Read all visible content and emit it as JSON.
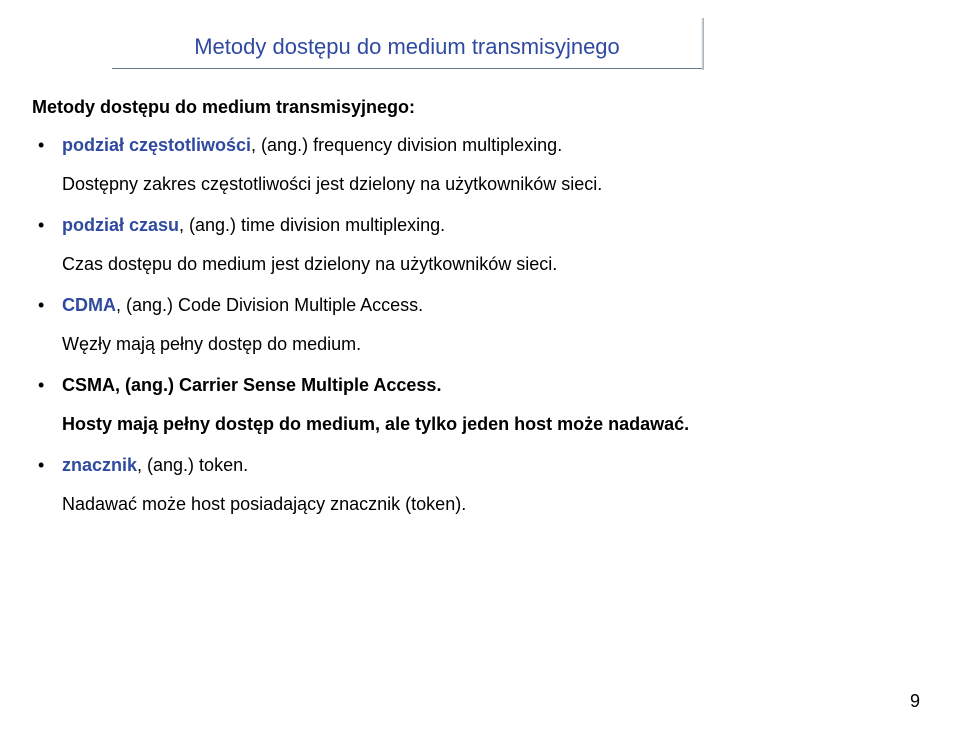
{
  "title": "Metody dostępu do medium transmisyjnego",
  "subheading": "Metody dostępu do medium transmisyjnego:",
  "items": [
    {
      "term": "podział częstotliwości",
      "after": ", (ang.) frequency division multiplexing.",
      "desc": "Dostępny zakres częstotliwości jest dzielony na użytkowników sieci."
    },
    {
      "term": "podział czasu",
      "after": ", (ang.) time division multiplexing.",
      "desc": "Czas dostępu do medium jest dzielony na użytkowników sieci."
    },
    {
      "term": "CDMA",
      "after": ", (ang.) Code Division Multiple Access.",
      "desc": "Węzły mają pełny dostęp do medium."
    },
    {
      "term": "CSMA, (ang.) Carrier Sense Multiple Access.",
      "after": "",
      "desc": "Hosty mają pełny dostęp do medium, ale tylko jeden host może nadawać."
    },
    {
      "term": "znacznik",
      "after": ", (ang.) token.",
      "desc": "Nadawać może host posiadający znacznik (token)."
    }
  ],
  "page_number": "9"
}
